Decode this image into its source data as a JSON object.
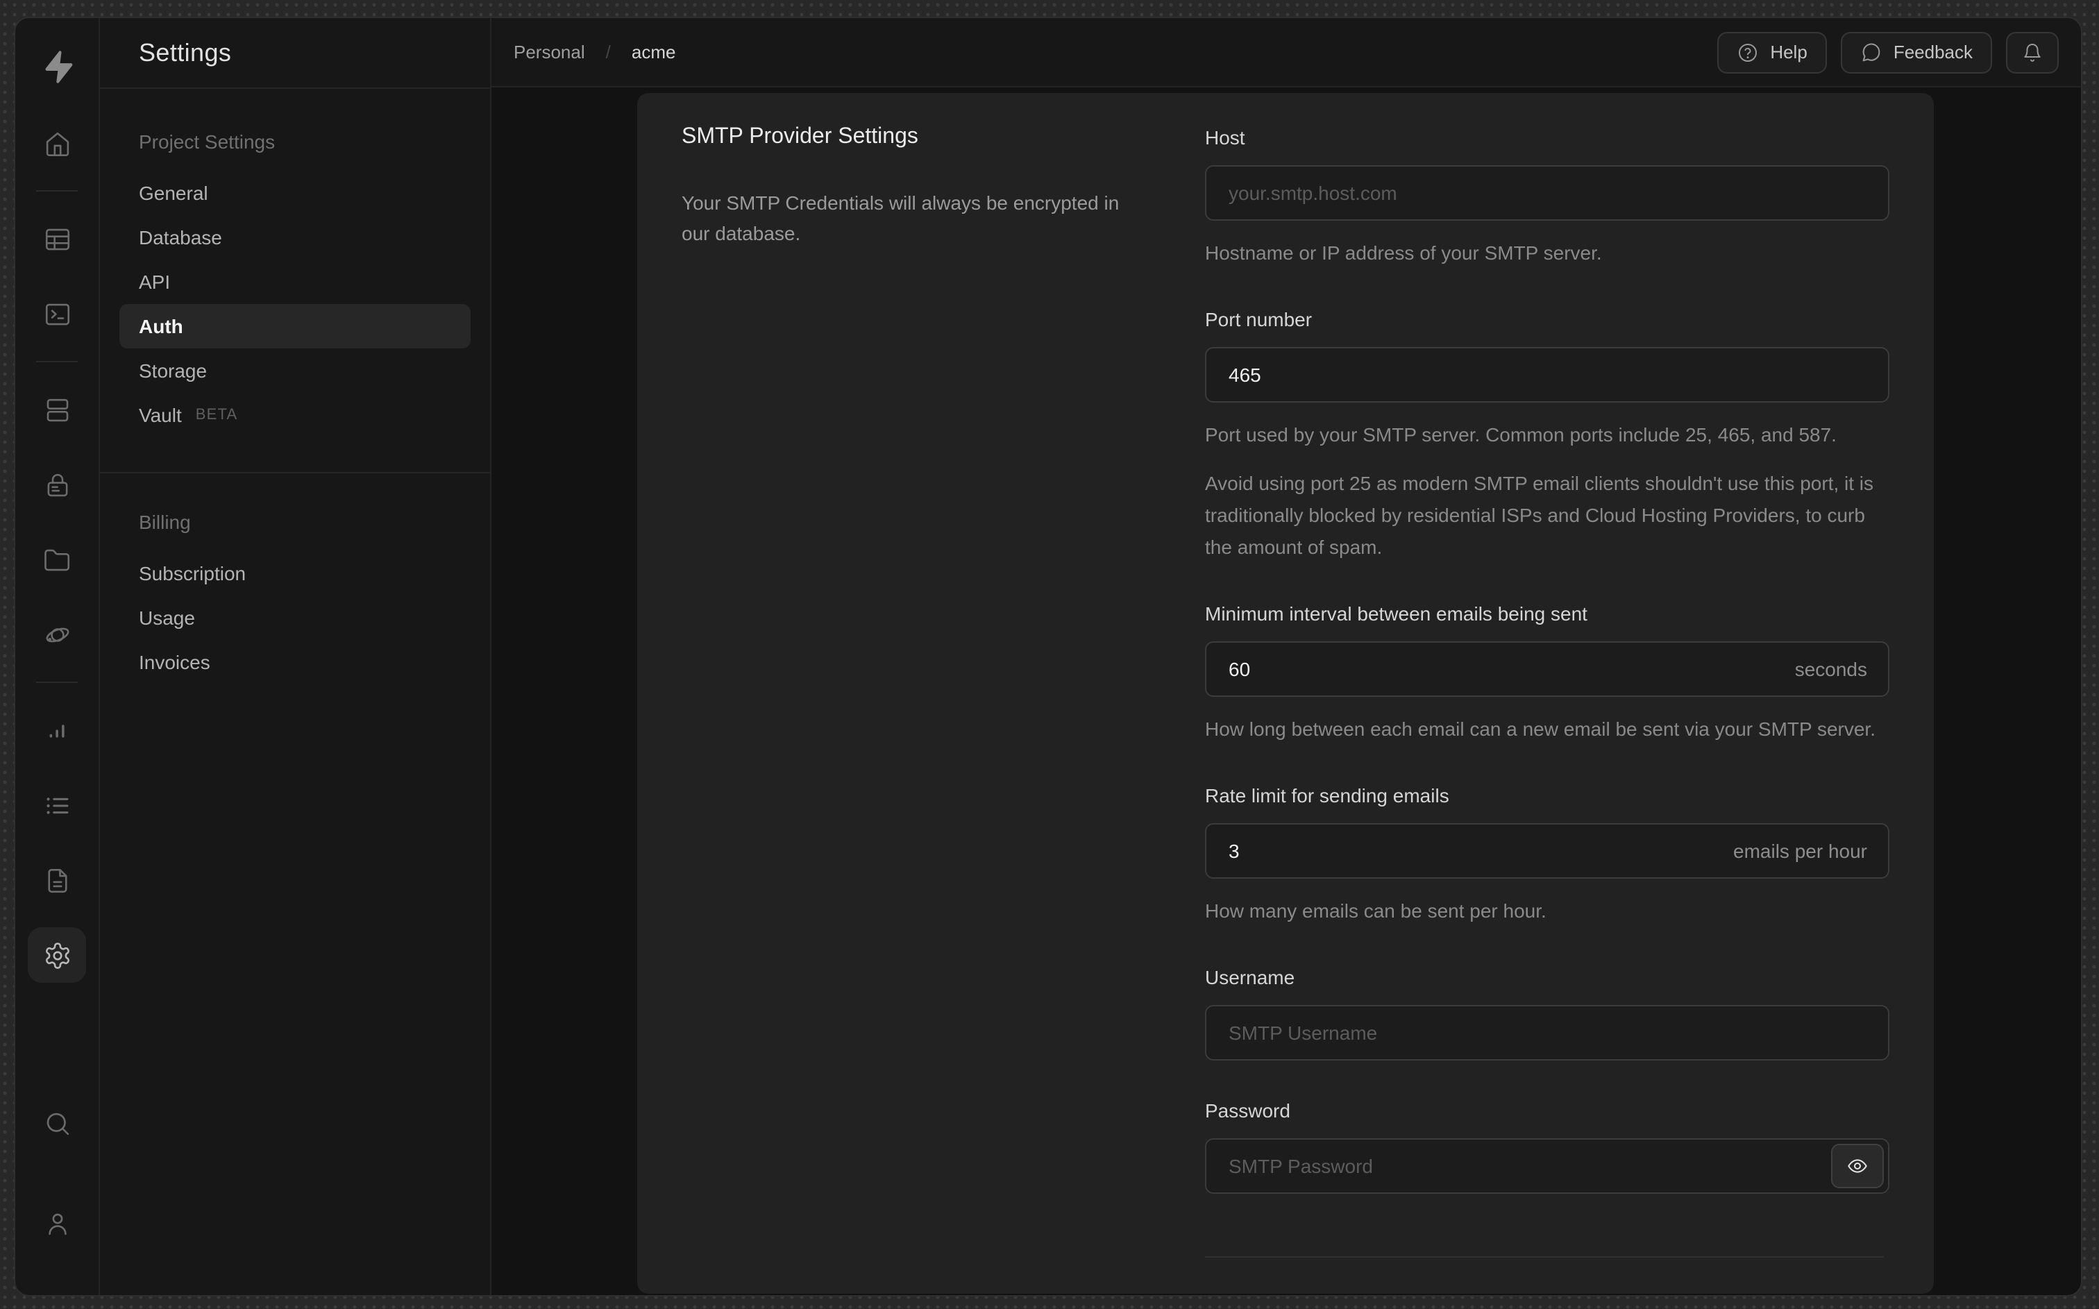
{
  "colors": {
    "outer_background": "#282828",
    "window_background": "#171717",
    "content_background": "#121212",
    "card_background": "#222222",
    "border": "#242424",
    "input_border": "#3b3b3b"
  },
  "rail": {
    "logo": "supabase-logo-icon",
    "nav": [
      {
        "name": "home-icon"
      },
      {
        "divider": true
      },
      {
        "name": "table-editor-icon"
      },
      {
        "name": "sql-editor-icon"
      },
      {
        "divider": true
      },
      {
        "name": "database-icon"
      },
      {
        "name": "auth-icon"
      },
      {
        "name": "storage-icon"
      },
      {
        "name": "edge-functions-icon"
      },
      {
        "divider": true
      },
      {
        "name": "reports-icon"
      },
      {
        "name": "logs-icon"
      },
      {
        "name": "docs-icon"
      },
      {
        "name": "settings-icon",
        "active": true
      }
    ],
    "bottom": [
      {
        "name": "search-icon"
      },
      {
        "name": "user-icon"
      }
    ]
  },
  "sidebar": {
    "title": "Settings",
    "sections": [
      {
        "label": "Project Settings",
        "items": [
          {
            "label": "General"
          },
          {
            "label": "Database"
          },
          {
            "label": "API"
          },
          {
            "label": "Auth",
            "active": true
          },
          {
            "label": "Storage"
          },
          {
            "label": "Vault",
            "badge": "BETA"
          }
        ]
      },
      {
        "label": "Billing",
        "items": [
          {
            "label": "Subscription"
          },
          {
            "label": "Usage"
          },
          {
            "label": "Invoices"
          }
        ]
      }
    ]
  },
  "topbar": {
    "breadcrumb": {
      "org": "Personal",
      "separator": "/",
      "project": "acme"
    },
    "buttons": {
      "help": "Help",
      "feedback": "Feedback",
      "notifications": "bell-icon"
    }
  },
  "content": {
    "section_title": "SMTP Provider Settings",
    "section_description": "Your SMTP Credentials will always be encrypted in our database.",
    "fields": [
      {
        "key": "host",
        "label": "Host",
        "value": "",
        "placeholder": "your.smtp.host.com",
        "helpers": [
          "Hostname or IP address of your SMTP server."
        ]
      },
      {
        "key": "port",
        "label": "Port number",
        "value": "465",
        "placeholder": "",
        "helpers": [
          "Port used by your SMTP server. Common ports include 25, 465, and 587.",
          "Avoid using port 25 as modern SMTP email clients shouldn't use this port, it is traditionally blocked by residential ISPs and Cloud Hosting Providers, to curb the amount of spam."
        ]
      },
      {
        "key": "minimum-interval",
        "label": "Minimum interval between emails being sent",
        "value": "60",
        "placeholder": "",
        "suffix": "seconds",
        "helpers": [
          "How long between each email can a new email be sent via your SMTP server."
        ]
      },
      {
        "key": "rate-limit",
        "label": "Rate limit for sending emails",
        "value": "3",
        "placeholder": "",
        "suffix": "emails per hour",
        "helpers": [
          "How many emails can be sent per hour."
        ]
      },
      {
        "key": "username",
        "label": "Username",
        "value": "",
        "placeholder": "SMTP Username",
        "helpers": []
      },
      {
        "key": "password",
        "label": "Password",
        "value": "",
        "placeholder": "SMTP Password",
        "password_toggle": true,
        "helpers": []
      }
    ]
  }
}
